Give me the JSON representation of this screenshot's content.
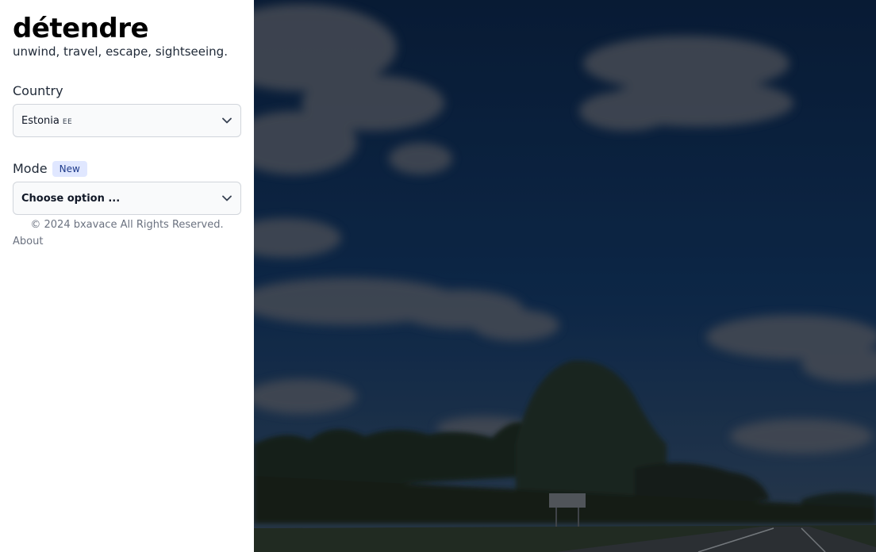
{
  "brand": {
    "title": "détendre",
    "tagline": "unwind, travel, escape, sightseeing."
  },
  "country": {
    "label": "Country",
    "selected": "Estonia",
    "flag_code": "EE",
    "icon": "chevron-down-icon"
  },
  "mode": {
    "label": "Mode",
    "badge": "New",
    "selected": "Choose option ...",
    "icon": "chevron-down-icon"
  },
  "footer": {
    "copyright": "© 2024 bxavace All Rights Reserved.",
    "about": "About"
  },
  "background": {
    "description_icon": "road-landscape-photo"
  },
  "colors": {
    "sky": "#0e2a4d",
    "badge_bg": "#e0e7ff",
    "badge_text": "#1e3a8a"
  }
}
